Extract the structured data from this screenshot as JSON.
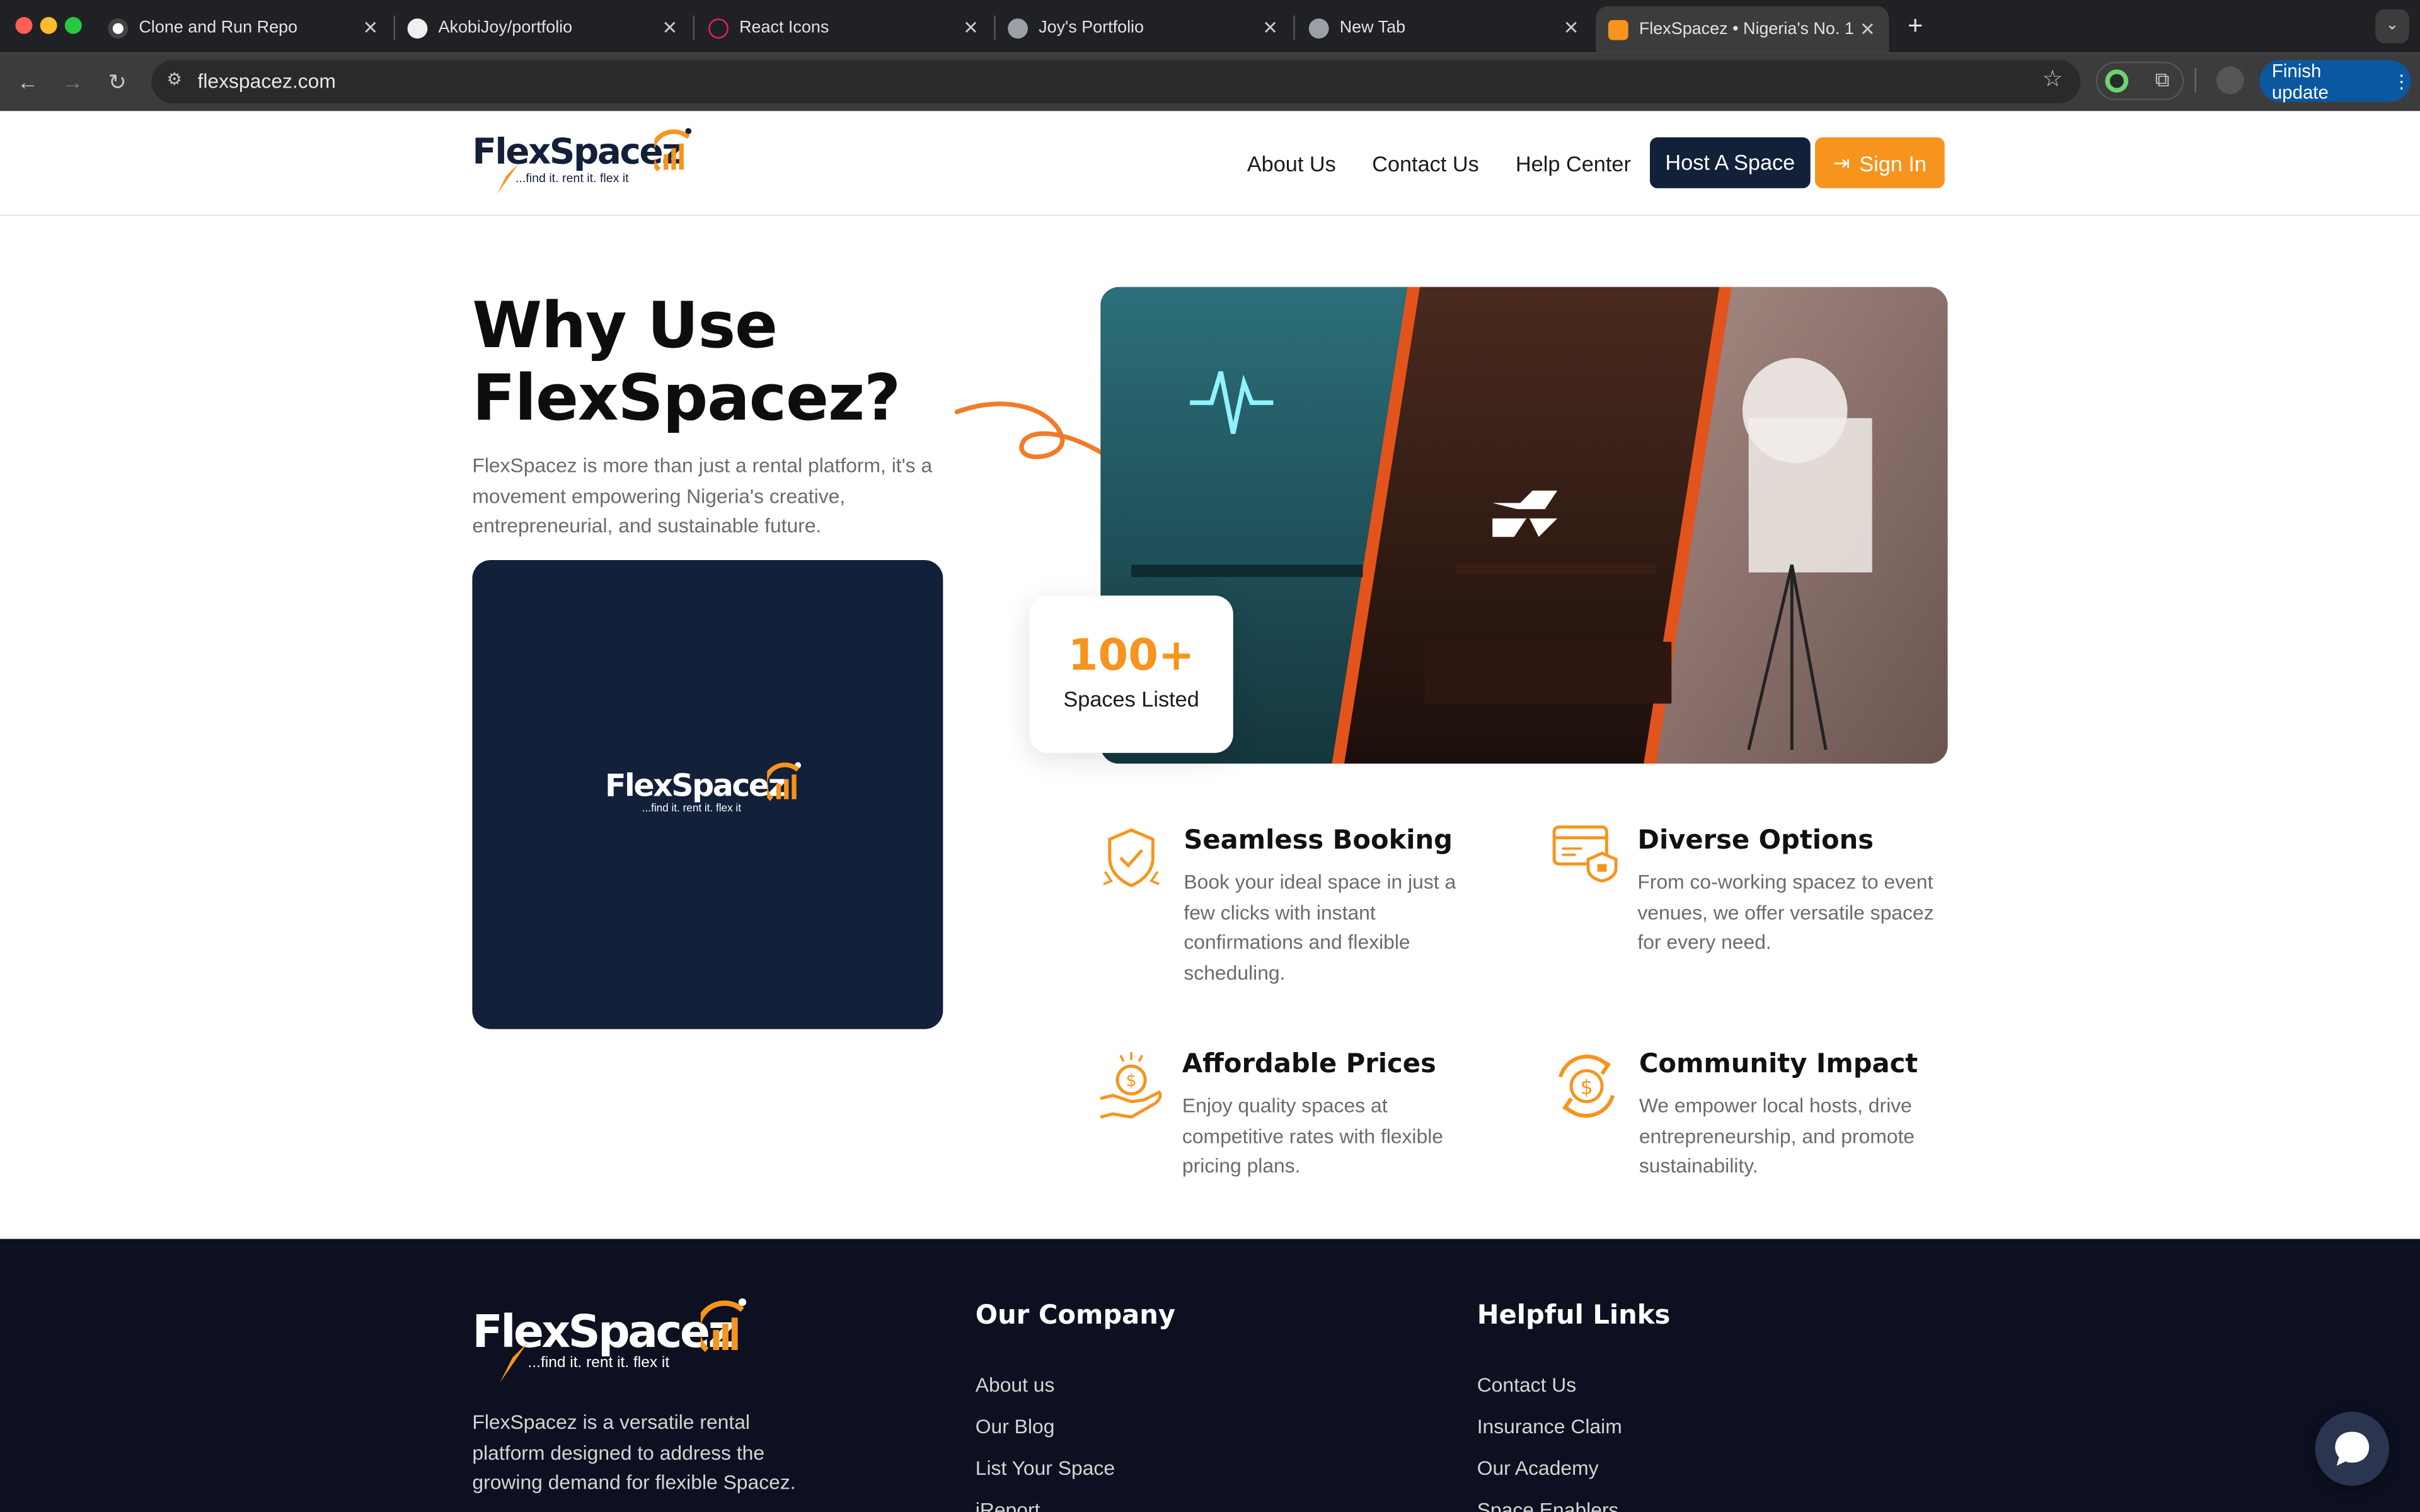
{
  "browser": {
    "tabs": [
      {
        "title": "Clone and Run Repo"
      },
      {
        "title": "AkobiJoy/portfolio"
      },
      {
        "title": "React Icons"
      },
      {
        "title": "Joy's Portfolio"
      },
      {
        "title": "New Tab"
      },
      {
        "title": "FlexSpacez • Nigeria's No. 1"
      }
    ],
    "new_tab": "+",
    "url": "flexspacez.com",
    "finish_update": "Finish update"
  },
  "header": {
    "logo_text": "FlexSpacez",
    "logo_tagline": "...find it. rent it. flex it",
    "nav": [
      "About Us",
      "Contact Us",
      "Help Center"
    ],
    "host_button": "Host A Space",
    "sign_in_button": "Sign In"
  },
  "hero": {
    "title": "Why Use FlexSpacez?",
    "lead": "FlexSpacez is more than just a rental platform, it's a movement empowering Nigeria's creative, entrepreneurial, and sustainable future.",
    "stat_value": "100+",
    "stat_label": "Spaces Listed",
    "features": [
      {
        "icon": "shield-check-icon",
        "title": "Seamless Booking",
        "text": "Book your ideal space in just a few clicks with instant confirmations and flexible scheduling."
      },
      {
        "icon": "card-lock-icon",
        "title": "Diverse Options",
        "text": "From co-working spacez to event venues, we offer versatile spacez for every need."
      },
      {
        "icon": "hand-coin-icon",
        "title": "Affordable Prices",
        "text": "Enjoy quality spaces at competitive rates with flexible pricing plans."
      },
      {
        "icon": "dollar-cycle-icon",
        "title": "Community Impact",
        "text": "We empower local hosts, drive entrepreneurship, and promote sustainability."
      }
    ]
  },
  "footer": {
    "description": "FlexSpacez is a versatile rental platform designed to address the growing demand for flexible Spacez.",
    "company_heading": "Our Company",
    "company_links": [
      "About us",
      "Our Blog",
      "List Your Space",
      "iReport"
    ],
    "helpful_heading": "Helpful Links",
    "helpful_links": [
      "Contact Us",
      "Insurance Claim",
      "Our Academy",
      "Space Enablers"
    ]
  },
  "colors": {
    "brand_orange": "#f7941d",
    "brand_navy": "#13203a",
    "footer_bg": "#0d1020"
  }
}
